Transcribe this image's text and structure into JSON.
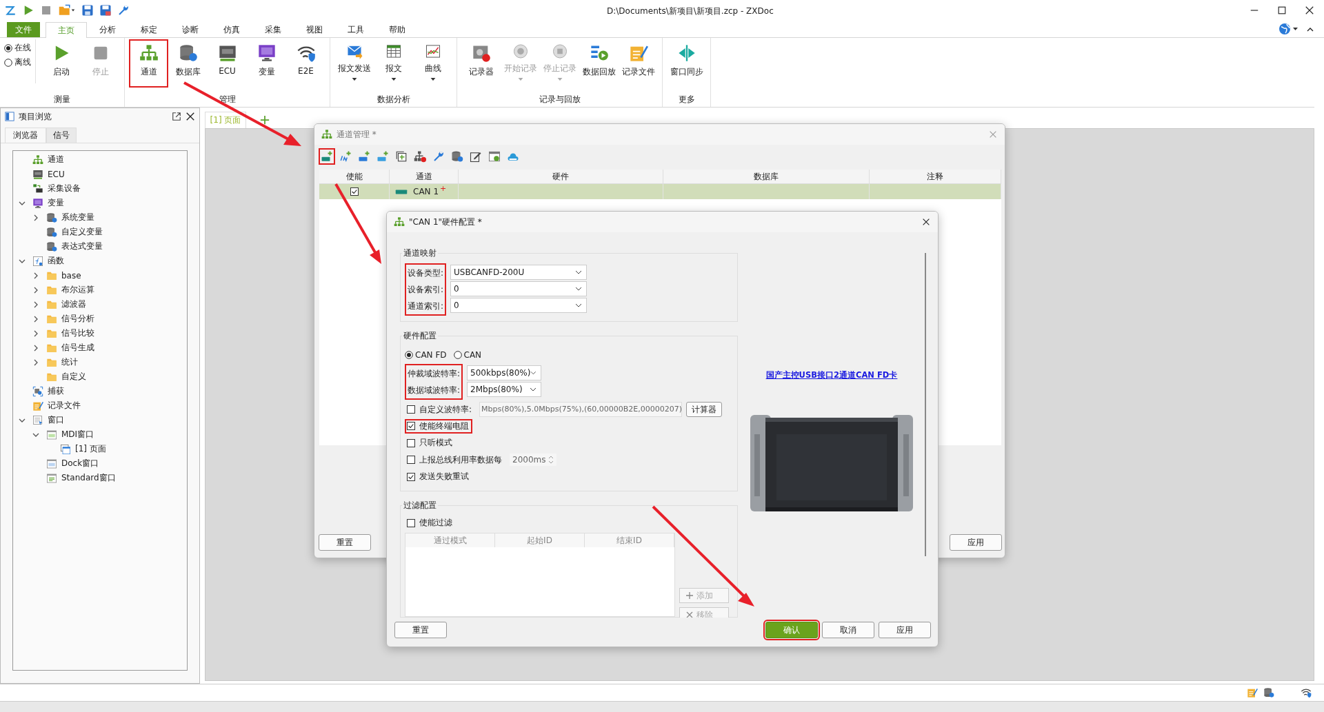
{
  "title_bar": {
    "title": "D:\\Documents\\新项目\\新项目.zcp - ZXDoc"
  },
  "menu": {
    "file": "文件",
    "tabs": [
      {
        "label": "主页",
        "selected": true
      },
      {
        "label": "分析",
        "selected": false
      },
      {
        "label": "标定",
        "selected": false
      },
      {
        "label": "诊断",
        "selected": false
      },
      {
        "label": "仿真",
        "selected": false
      },
      {
        "label": "采集",
        "selected": false
      },
      {
        "label": "视图",
        "selected": false
      },
      {
        "label": "工具",
        "selected": false
      },
      {
        "label": "帮助",
        "selected": false
      }
    ]
  },
  "ribbon": {
    "groups": [
      {
        "label": "测量",
        "modes": [
          {
            "label": "在线",
            "selected": true
          },
          {
            "label": "离线",
            "selected": false
          }
        ],
        "items": [
          {
            "kind": "play",
            "label": "启动",
            "disabled": false,
            "dropdown": false,
            "highlighted": false
          },
          {
            "kind": "stop",
            "label": "停止",
            "disabled": true,
            "dropdown": false,
            "highlighted": false
          }
        ]
      },
      {
        "label": "管理",
        "items": [
          {
            "kind": "network",
            "label": "通道",
            "disabled": false,
            "dropdown": false,
            "highlighted": true
          },
          {
            "kind": "database",
            "label": "数据库",
            "disabled": false,
            "dropdown": false,
            "highlighted": false
          },
          {
            "kind": "ecu",
            "label": "ECU",
            "disabled": false,
            "dropdown": false,
            "highlighted": false
          },
          {
            "kind": "var",
            "label": "变量",
            "disabled": false,
            "dropdown": false,
            "highlighted": false
          },
          {
            "kind": "e2e",
            "label": "E2E",
            "disabled": false,
            "dropdown": false,
            "highlighted": false
          }
        ]
      },
      {
        "label": "数据分析",
        "items": [
          {
            "kind": "mail",
            "label": "报文发送",
            "disabled": false,
            "dropdown": true,
            "highlighted": false
          },
          {
            "kind": "table",
            "label": "报文",
            "disabled": false,
            "dropdown": true,
            "highlighted": false
          },
          {
            "kind": "chart",
            "label": "曲线",
            "disabled": false,
            "dropdown": true,
            "highlighted": false
          }
        ]
      },
      {
        "label": "记录与回放",
        "items": [
          {
            "kind": "recorder",
            "label": "记录器",
            "disabled": false,
            "dropdown": false,
            "highlighted": false
          },
          {
            "kind": "rec-start",
            "label": "开始记录",
            "disabled": true,
            "dropdown": true,
            "highlighted": false
          },
          {
            "kind": "rec-stop",
            "label": "停止记录",
            "disabled": true,
            "dropdown": true,
            "highlighted": false
          },
          {
            "kind": "playback",
            "label": "数据回放",
            "disabled": false,
            "dropdown": false,
            "highlighted": false
          },
          {
            "kind": "logfile",
            "label": "记录文件",
            "disabled": false,
            "dropdown": false,
            "highlighted": false
          }
        ]
      },
      {
        "label": "更多",
        "items": [
          {
            "kind": "sync",
            "label": "窗口同步",
            "disabled": false,
            "dropdown": false,
            "highlighted": false
          }
        ]
      }
    ]
  },
  "project_browser": {
    "title": "项目浏览",
    "tabs": [
      {
        "label": "浏览器",
        "selected": true
      },
      {
        "label": "信号",
        "selected": false
      }
    ],
    "tree": [
      {
        "kind": "network",
        "label": "通道"
      },
      {
        "kind": "ecu",
        "label": "ECU"
      },
      {
        "kind": "device",
        "label": "采集设备"
      },
      {
        "kind": "var",
        "label": "变量",
        "expanded": true,
        "children": [
          {
            "kind": "dbgear",
            "label": "系统变量",
            "expanded": false
          },
          {
            "kind": "dbgear",
            "label": "自定义变量"
          },
          {
            "kind": "dbgear",
            "label": "表达式变量"
          }
        ]
      },
      {
        "kind": "function",
        "label": "函数",
        "expanded": true,
        "children": [
          {
            "kind": "folder",
            "label": "base",
            "expanded": false
          },
          {
            "kind": "folder",
            "label": "布尔运算",
            "expanded": false
          },
          {
            "kind": "folder",
            "label": "滤波器",
            "expanded": false
          },
          {
            "kind": "folder",
            "label": "信号分析",
            "expanded": false
          },
          {
            "kind": "folder",
            "label": "信号比较",
            "expanded": false
          },
          {
            "kind": "folder",
            "label": "信号生成",
            "expanded": false
          },
          {
            "kind": "folder",
            "label": "统计",
            "expanded": false
          },
          {
            "kind": "folder",
            "label": "自定义"
          }
        ]
      },
      {
        "kind": "capture",
        "label": "捕获"
      },
      {
        "kind": "logfile",
        "label": "记录文件"
      },
      {
        "kind": "window",
        "label": "窗口",
        "expanded": true,
        "children": [
          {
            "kind": "mdi",
            "label": "MDI窗口",
            "expanded": true,
            "children": [
              {
                "kind": "page",
                "label": "[1] 页面"
              }
            ]
          },
          {
            "kind": "dock",
            "label": "Dock窗口"
          },
          {
            "kind": "standard",
            "label": "Standard窗口"
          }
        ]
      }
    ]
  },
  "mdi": {
    "tabs": [
      {
        "label": "[1] 页面",
        "selected": true
      }
    ]
  },
  "channel_manager": {
    "title": "通道管理 *",
    "toolbar": [
      {
        "kind": "can-add",
        "highlighted": true
      },
      {
        "kind": "lin-add",
        "highlighted": false
      },
      {
        "kind": "eth-add",
        "highlighted": false
      },
      {
        "kind": "gps-add",
        "highlighted": false
      },
      {
        "kind": "copy",
        "highlighted": false
      },
      {
        "kind": "net-remove",
        "highlighted": false
      },
      {
        "kind": "wrench",
        "highlighted": false
      },
      {
        "kind": "dbgear",
        "highlighted": false
      },
      {
        "kind": "edit",
        "highlighted": false
      },
      {
        "kind": "winset",
        "highlighted": false
      },
      {
        "kind": "cloud",
        "highlighted": false
      }
    ],
    "columns": [
      "使能",
      "通道",
      "硬件",
      "数据库",
      "注释"
    ],
    "rows": [
      {
        "enabled": true,
        "channel": "CAN 1",
        "mark": "+",
        "selected": true
      }
    ],
    "buttons": [
      "重置",
      "应用"
    ]
  },
  "hardware_dialog": {
    "title": "\"CAN 1\"硬件配置 *",
    "mapping": {
      "title": "通道映射",
      "highlighted": true,
      "fields": [
        {
          "label": "设备类型:",
          "value": "USBCANFD-200U"
        },
        {
          "label": "设备索引:",
          "value": "0"
        },
        {
          "label": "通道索引:",
          "value": "0"
        }
      ]
    },
    "hardware": {
      "title": "硬件配置",
      "protocols": [
        {
          "label": "CAN FD",
          "selected": true
        },
        {
          "label": "CAN",
          "selected": false
        }
      ],
      "bauds_highlighted": true,
      "bauds": [
        {
          "label": "仲裁域波特率:",
          "value": "500kbps(80%)"
        },
        {
          "label": "数据域波特率:",
          "value": "2Mbps(80%)"
        }
      ],
      "custom_baud": {
        "label": "自定义波特率:",
        "checked": false,
        "value": "Mbps(80%),5.0Mbps(75%),(60,00000B2E,00000207)",
        "button": "计算器"
      },
      "options": [
        {
          "kind": "check",
          "label": "使能终端电阻",
          "checked": true,
          "highlighted": true
        },
        {
          "kind": "check",
          "label": "只听模式",
          "checked": false,
          "highlighted": false
        },
        {
          "kind": "spin",
          "label": "上报总线利用率数据每",
          "checked": false,
          "highlighted": false,
          "value": "2000ms"
        },
        {
          "kind": "check",
          "label": "发送失败重试",
          "checked": true,
          "highlighted": false
        }
      ]
    },
    "filter": {
      "title": "过滤配置",
      "enable": {
        "label": "使能过滤",
        "checked": false
      },
      "columns": [
        "通过模式",
        "起始ID",
        "结束ID"
      ],
      "actions": [
        {
          "kind": "add",
          "label": "添加",
          "disabled": true
        },
        {
          "kind": "remove",
          "label": "移除",
          "disabled": true
        }
      ]
    },
    "link": "国产主控USB接口2通道CAN FD卡",
    "buttons": [
      {
        "kind": "normal",
        "label": "重置",
        "highlighted": false
      },
      {
        "kind": "primary",
        "label": "确认",
        "highlighted": true
      },
      {
        "kind": "normal",
        "label": "取消",
        "highlighted": false
      },
      {
        "kind": "normal",
        "label": "应用",
        "highlighted": false
      }
    ]
  }
}
